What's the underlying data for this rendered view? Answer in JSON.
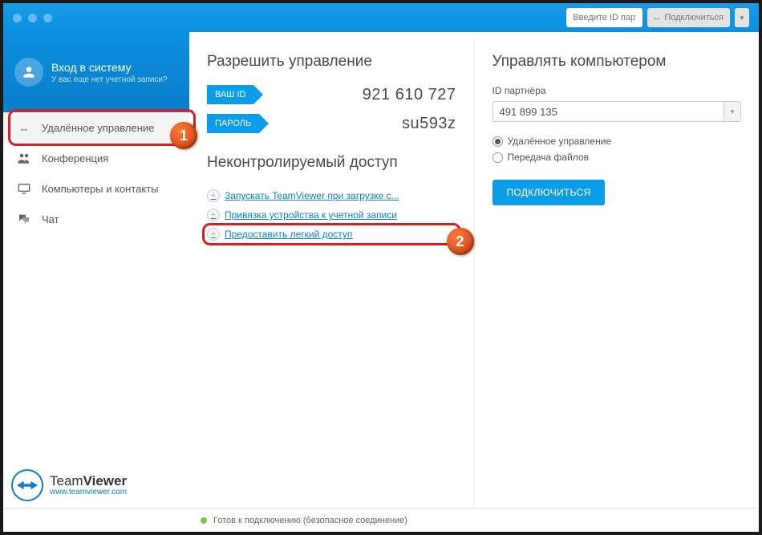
{
  "toolbar": {
    "partner_id_placeholder": "Введите ID партн",
    "connect_label": "Подключиться"
  },
  "login": {
    "title": "Вход в систему",
    "subtitle": "У вас еще нет учетной записи?"
  },
  "nav": {
    "remote": "Удалённое управление",
    "conference": "Конференция",
    "contacts": "Компьютеры и контакты",
    "chat": "Чат"
  },
  "allow": {
    "heading": "Разрешить управление",
    "id_label": "ВАШ ID",
    "id_value": "921 610 727",
    "pw_label": "ПАРОЛЬ",
    "pw_value": "su593z",
    "section2_heading": "Неконтролируемый доступ",
    "link1": "Запускать TeamViewer при загрузке с...",
    "link2": "Привязка устройства к учетной записи",
    "link3": "Предоставить легкий доступ"
  },
  "control": {
    "heading": "Управлять компьютером",
    "partner_label": "ID партнёра",
    "partner_value": "491 899 135",
    "radio_remote": "Удалённое управление",
    "radio_files": "Передача файлов",
    "connect_btn": "ПОДКЛЮЧИТЬСЯ"
  },
  "brand": {
    "line1a": "Team",
    "line1b": "Viewer",
    "url": "www.teamviewer.com"
  },
  "status": {
    "text": "Готов к подключению (безопасное соединение)"
  },
  "annotations": {
    "b1": "1",
    "b2": "2"
  }
}
